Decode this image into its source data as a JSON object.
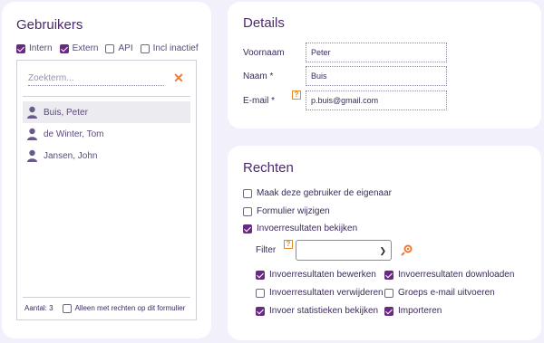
{
  "users_panel": {
    "title": "Gebruikers",
    "filters": [
      {
        "label": "Intern",
        "checked": true
      },
      {
        "label": "Extern",
        "checked": true
      },
      {
        "label": "API",
        "checked": false
      },
      {
        "label": "Incl inactief",
        "checked": false
      }
    ],
    "search_placeholder": "Zoekterm...",
    "users": [
      {
        "name": "Buis, Peter",
        "selected": true
      },
      {
        "name": "de Winter, Tom",
        "selected": false
      },
      {
        "name": "Jansen, John",
        "selected": false
      }
    ],
    "count_label": "Aantal: 3",
    "only_rights_label": "Alleen met rechten op dit formulier"
  },
  "details_panel": {
    "title": "Details",
    "first_name_label": "Voornaam",
    "first_name_value": "Peter",
    "last_name_label": "Naam *",
    "last_name_value": "Buis",
    "email_label": "E-mail *",
    "email_value": "p.buis@gmail.com",
    "help_glyph": "?"
  },
  "rights_panel": {
    "title": "Rechten",
    "owner_label": "Maak deze gebruiker de eigenaar",
    "owner_checked": false,
    "edit_form_label": "Formulier wijzigen",
    "edit_form_checked": false,
    "view_results_label": "Invoerresultaten bekijken",
    "view_results_checked": true,
    "filter_label": "Filter",
    "filter_value": "",
    "help_glyph": "?",
    "sub_rights": [
      {
        "label": "Invoerresultaten bewerken",
        "checked": true
      },
      {
        "label": "Invoerresultaten downloaden",
        "checked": true
      },
      {
        "label": "Invoerresultaten verwijderen",
        "checked": false
      },
      {
        "label": "Groeps e-mail uitvoeren",
        "checked": false
      },
      {
        "label": "Invoer statistieken bekijken",
        "checked": true
      },
      {
        "label": "Importeren",
        "checked": true
      }
    ]
  },
  "colors": {
    "accent": "#6a2a84",
    "orange": "#f07a34",
    "background": "#f1f0fb"
  }
}
